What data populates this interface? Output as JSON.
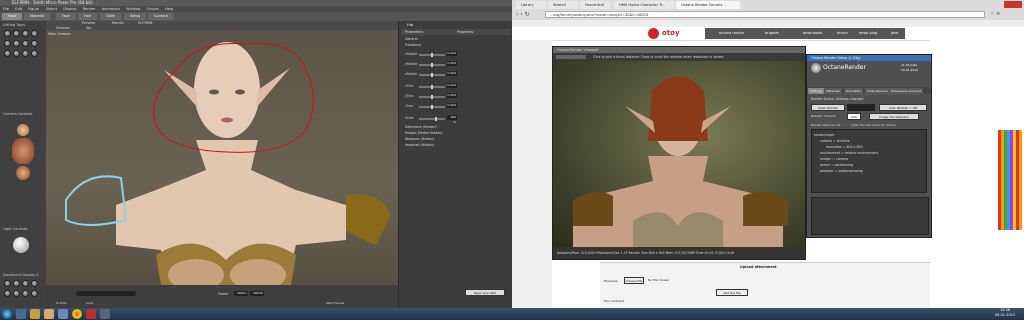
{
  "poser": {
    "title": "ELF.PBIN - Smith Micro Poser Pro (64-bit)",
    "menu": [
      "File",
      "Edit",
      "Figure",
      "Object",
      "Display",
      "Render",
      "Animation",
      "Window",
      "Scripts",
      "Help"
    ],
    "rooms": [
      "Pose",
      "Material",
      "Face",
      "Hair",
      "Cloth",
      "Setup",
      "Content"
    ],
    "left_panels": {
      "editing_tools": "Editing Tools",
      "camera_controls": "Camera Controls",
      "light_controls": "Light Controls",
      "document_display": "Document Display S"
    },
    "viewport_tabs": [
      "Preview",
      "Render",
      "ELF.PBIN"
    ],
    "camera_label": "Main Camera",
    "doc_selector": "Victorian",
    "hip_selector": "Hip",
    "right_panel": {
      "title": "Hip",
      "tabs": [
        "Parameters",
        "Properties"
      ],
      "groups": [
        "General",
        "Transform",
        "Deformers (Hidden)",
        "Morphs (Partial Hidden)",
        "Weapons (Hidden)",
        "Imported (Hidden)"
      ],
      "params": [
        {
          "label": "xRotate",
          "value": "0.000"
        },
        {
          "label": "yRotate",
          "value": "0.000"
        },
        {
          "label": "zRotate",
          "value": "0.000"
        },
        {
          "label": "xTran",
          "value": "0.000"
        },
        {
          "label": "yTran",
          "value": "0.000"
        },
        {
          "label": "zTran",
          "value": "0.000"
        },
        {
          "label": "Scale",
          "value": "100 %"
        }
      ]
    },
    "bottom": {
      "frame_label": "Frame",
      "frame_value": "00001",
      "of_value": "00030",
      "ui_dots": "UI Dots",
      "loop": "Loop",
      "ping_pong": "Ping Pong",
      "skip_frames": "Skip Frames"
    },
    "open_button": "Open Live GPU"
  },
  "chrome": {
    "tabs": [
      "Library",
      "Stretch",
      "Fancentral",
      "HMX Hydra Character Tr...",
      "Octane Render Forums ..."
    ],
    "url": "...org/forum/posting.php?mode=reply&f=40&t=26624",
    "site_logo": "otoy",
    "nav": [
      "octane render",
      "brigade",
      "downloads",
      "forum",
      "news blog",
      "jobs"
    ]
  },
  "octane_viewport": {
    "title": "Octane Render Viewport",
    "hint": "Click to pick a focus distance. Drag to scroll the window when resolution is locked.",
    "stats": "Samples/Pixel 121/1000  MSamples/Sec 1.25  Render Size 800 x 600  Mem 707/3072MB  Time 00:01:37/00:13:48"
  },
  "octane_settings": {
    "title": "Octane Render Setup (1.03g)",
    "brand": "OctaneRender",
    "version": "v1.01 beta",
    "build_date": "10.01.2012",
    "tabs": [
      "Settings",
      "Materials",
      "Animation",
      "Cuda Devices",
      "OctaneLive Account"
    ],
    "render_status_label": "Render Status: Settings changed",
    "open_render_button": "Open Render",
    "auto_refresh": "Auto Refresh = Off",
    "refresh_label": "Refresh Timeout",
    "refresh_value": "200",
    "image_stats_button": "Image File Statistics",
    "render_options_label": "Render Options List",
    "render_options_hint": "right click tree items for options",
    "tree": [
      "rendertarget",
      "camera = thinlens",
      "resolution = 800 x 600",
      "environment = texture environment",
      "imager = camera",
      "kernel = pathtracing",
      "postproc = postprocessing"
    ]
  },
  "forum": {
    "upload_label": "Upload attachment",
    "choose_file": "Choose File",
    "no_file": "No file chosen",
    "add_file": "Add the file",
    "filename_label": "Filename",
    "file_comment": "File comment"
  },
  "taskbar": {
    "time": "13:46",
    "date": "09-01-2012"
  }
}
